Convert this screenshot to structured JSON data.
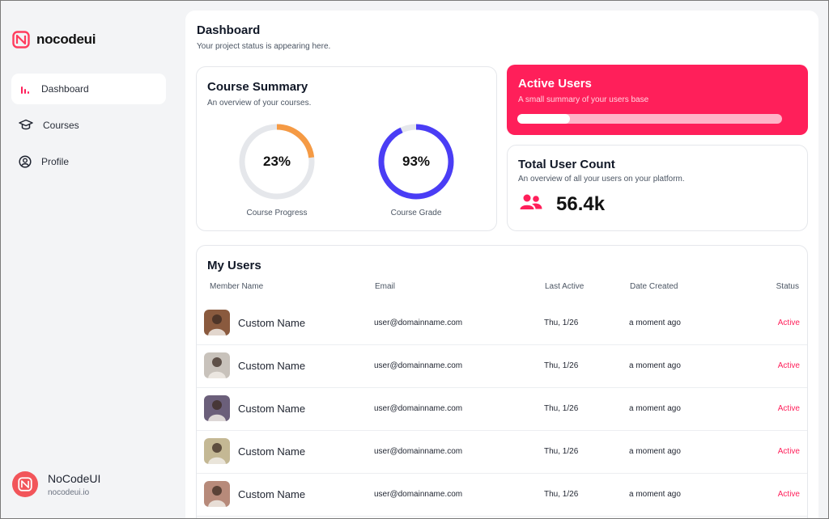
{
  "brand": {
    "name": "nocodeui",
    "accent": "#ff1f5a",
    "logo_icon": "nocodeui-logo-icon"
  },
  "sidebar": {
    "items": [
      {
        "label": "Dashboard",
        "icon": "bar-chart-icon",
        "active": true
      },
      {
        "label": "Courses",
        "icon": "graduation-cap-icon",
        "active": false
      },
      {
        "label": "Profile",
        "icon": "user-circle-icon",
        "active": false
      }
    ],
    "user": {
      "name": "NoCodeUI",
      "site": "nocodeui.io"
    }
  },
  "header": {
    "title": "Dashboard",
    "subtitle": "Your project status is appearing here."
  },
  "course_summary": {
    "title": "Course Summary",
    "subtitle": "An overview of your courses.",
    "progress": {
      "value": 23,
      "display": "23%",
      "label": "Course Progress",
      "color": "#f59a44"
    },
    "grade": {
      "value": 93,
      "display": "93%",
      "label": "Course Grade",
      "color": "#4a3df5"
    }
  },
  "active_users": {
    "title": "Active Users",
    "subtitle": "A small summary of your users base",
    "fill_fraction": 0.2
  },
  "total_users": {
    "title": "Total User Count",
    "subtitle": "An overview of all your users on your platform.",
    "value": "56.4k",
    "icon": "users-icon"
  },
  "users_table": {
    "title": "My Users",
    "columns": [
      "Member Name",
      "Email",
      "Last Active",
      "Date Created",
      "Status"
    ],
    "rows": [
      {
        "name": "Custom Name",
        "email": "user@domainname.com",
        "last_active": "Thu, 1/26",
        "created": "a moment ago",
        "status": "Active",
        "avatar_bg": "#8a5a3e"
      },
      {
        "name": "Custom Name",
        "email": "user@domainname.com",
        "last_active": "Thu, 1/26",
        "created": "a moment ago",
        "status": "Active",
        "avatar_bg": "#c8c2bb"
      },
      {
        "name": "Custom Name",
        "email": "user@domainname.com",
        "last_active": "Thu, 1/26",
        "created": "a moment ago",
        "status": "Active",
        "avatar_bg": "#6b5f7a"
      },
      {
        "name": "Custom Name",
        "email": "user@domainname.com",
        "last_active": "Thu, 1/26",
        "created": "a moment ago",
        "status": "Active",
        "avatar_bg": "#c4b894"
      },
      {
        "name": "Custom Name",
        "email": "user@domainname.com",
        "last_active": "Thu, 1/26",
        "created": "a moment ago",
        "status": "Active",
        "avatar_bg": "#b78a7a"
      }
    ]
  }
}
